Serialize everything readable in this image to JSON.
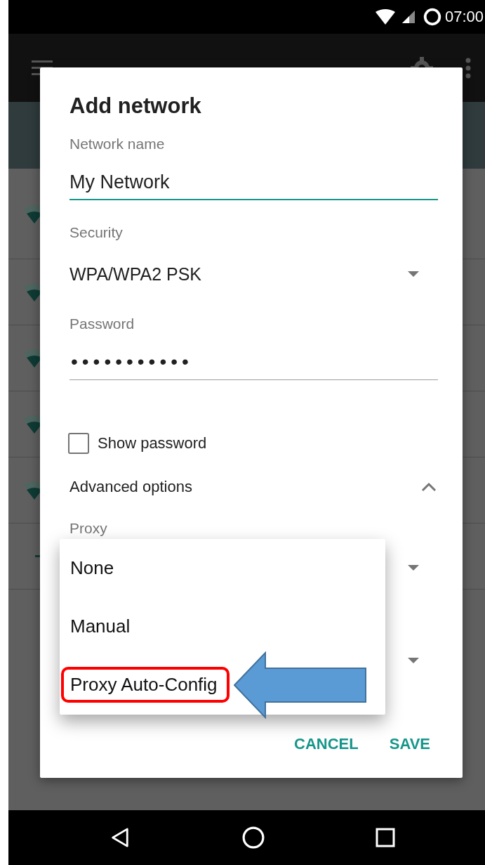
{
  "status_bar": {
    "time": "07:00"
  },
  "dialog": {
    "title": "Add network",
    "fields": [
      {
        "kind": "text",
        "label": "Network name",
        "value": "My Network",
        "focused": true
      },
      {
        "kind": "select",
        "label": "Security",
        "value": "WPA/WPA2 PSK"
      },
      {
        "kind": "password",
        "label": "Password",
        "value": "•••••••••••",
        "focused": false
      }
    ],
    "show_password": {
      "label": "Show password",
      "checked": false
    },
    "advanced": {
      "label": "Advanced options",
      "expanded": true
    },
    "proxy": {
      "label": "Proxy"
    },
    "buttons": [
      "CANCEL",
      "SAVE"
    ]
  },
  "dropdown": {
    "options": [
      {
        "label": "None",
        "highlighted": false
      },
      {
        "label": "Manual",
        "highlighted": false
      },
      {
        "label": "Proxy Auto-Config",
        "highlighted": true
      }
    ]
  }
}
